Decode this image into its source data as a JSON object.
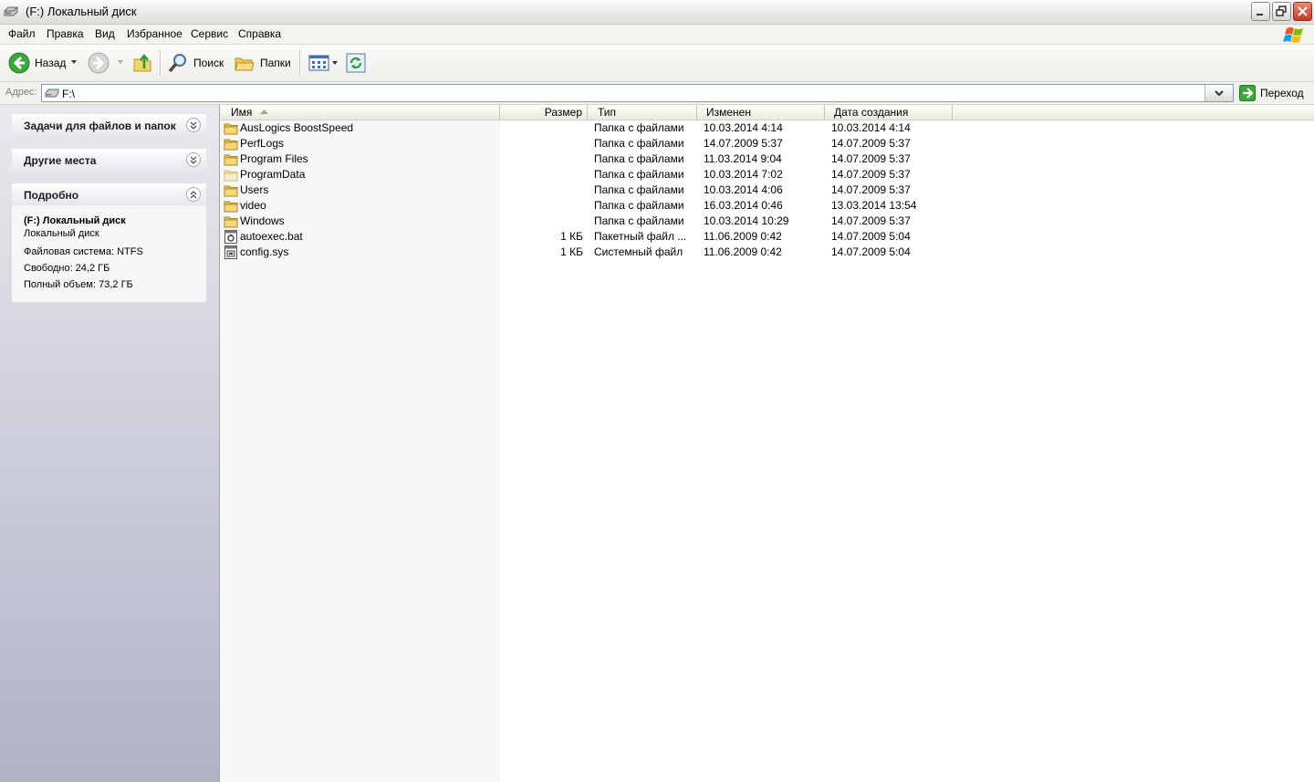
{
  "window": {
    "title": "(F:) Локальный диск"
  },
  "menu": [
    "Файл",
    "Правка",
    "Вид",
    "Избранное",
    "Сервис",
    "Справка"
  ],
  "toolbar": {
    "back_label": "Назад",
    "search_label": "Поиск",
    "folders_label": "Папки"
  },
  "address": {
    "label": "Адрес:",
    "value": "F:\\",
    "go_label": "Переход"
  },
  "sidebar": {
    "tasks_title": "Задачи для файлов и папок",
    "places_title": "Другие места",
    "details_title": "Подробно",
    "details": {
      "name": "(F:) Локальный диск",
      "type": "Локальный диск",
      "filesystem": "Файловая система: NTFS",
      "free": "Свободно: 24,2 ГБ",
      "total": "Полный объем: 73,2 ГБ"
    }
  },
  "columns": {
    "name": "Имя",
    "size": "Размер",
    "type": "Тип",
    "modified": "Изменен",
    "created": "Дата создания"
  },
  "files": [
    {
      "name": "AusLogics BoostSpeed",
      "size": "",
      "type": "Папка с файлами",
      "modified": "10.03.2014 4:14",
      "created": "10.03.2014 4:14",
      "icon": "folder-icon"
    },
    {
      "name": "PerfLogs",
      "size": "",
      "type": "Папка с файлами",
      "modified": "14.07.2009 5:37",
      "created": "14.07.2009 5:37",
      "icon": "folder-icon"
    },
    {
      "name": "Program Files",
      "size": "",
      "type": "Папка с файлами",
      "modified": "11.03.2014 9:04",
      "created": "14.07.2009 5:37",
      "icon": "folder-icon"
    },
    {
      "name": "ProgramData",
      "size": "",
      "type": "Папка с файлами",
      "modified": "10.03.2014 7:02",
      "created": "14.07.2009 5:37",
      "icon": "hidden-folder-icon"
    },
    {
      "name": "Users",
      "size": "",
      "type": "Папка с файлами",
      "modified": "10.03.2014 4:06",
      "created": "14.07.2009 5:37",
      "icon": "folder-icon"
    },
    {
      "name": "video",
      "size": "",
      "type": "Папка с файлами",
      "modified": "16.03.2014 0:46",
      "created": "13.03.2014 13:54",
      "icon": "folder-icon"
    },
    {
      "name": "Windows",
      "size": "",
      "type": "Папка с файлами",
      "modified": "10.03.2014 10:29",
      "created": "14.07.2009 5:37",
      "icon": "folder-icon"
    },
    {
      "name": "autoexec.bat",
      "size": "1 КБ",
      "type": "Пакетный файл ...",
      "modified": "11.06.2009 0:42",
      "created": "14.07.2009 5:04",
      "icon": "batch-file-icon"
    },
    {
      "name": "config.sys",
      "size": "1 КБ",
      "type": "Системный файл",
      "modified": "11.06.2009 0:42",
      "created": "14.07.2009 5:04",
      "icon": "system-file-icon"
    }
  ]
}
